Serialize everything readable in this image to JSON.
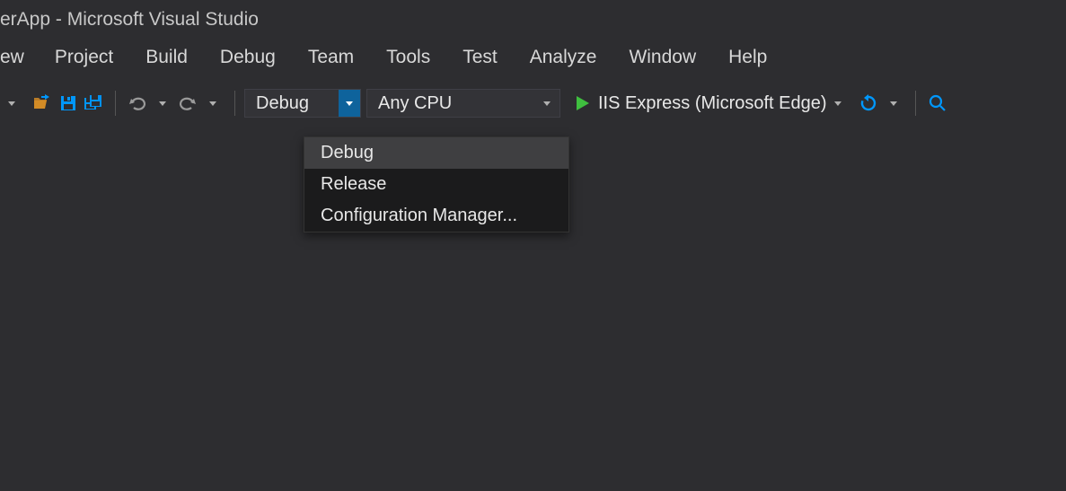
{
  "titlebar": {
    "text": "erApp - Microsoft Visual Studio"
  },
  "menubar": {
    "items": [
      {
        "label": "ew"
      },
      {
        "label": "Project"
      },
      {
        "label": "Build"
      },
      {
        "label": "Debug"
      },
      {
        "label": "Team"
      },
      {
        "label": "Tools"
      },
      {
        "label": "Test"
      },
      {
        "label": "Analyze"
      },
      {
        "label": "Window"
      },
      {
        "label": "Help"
      }
    ]
  },
  "toolbar": {
    "config_selected": "Debug",
    "platform_selected": "Any CPU",
    "run_label": "IIS Express (Microsoft Edge)"
  },
  "config_dropdown": {
    "items": [
      {
        "label": "Debug",
        "selected": true
      },
      {
        "label": "Release",
        "selected": false
      },
      {
        "label": "Configuration Manager...",
        "selected": false
      }
    ]
  }
}
